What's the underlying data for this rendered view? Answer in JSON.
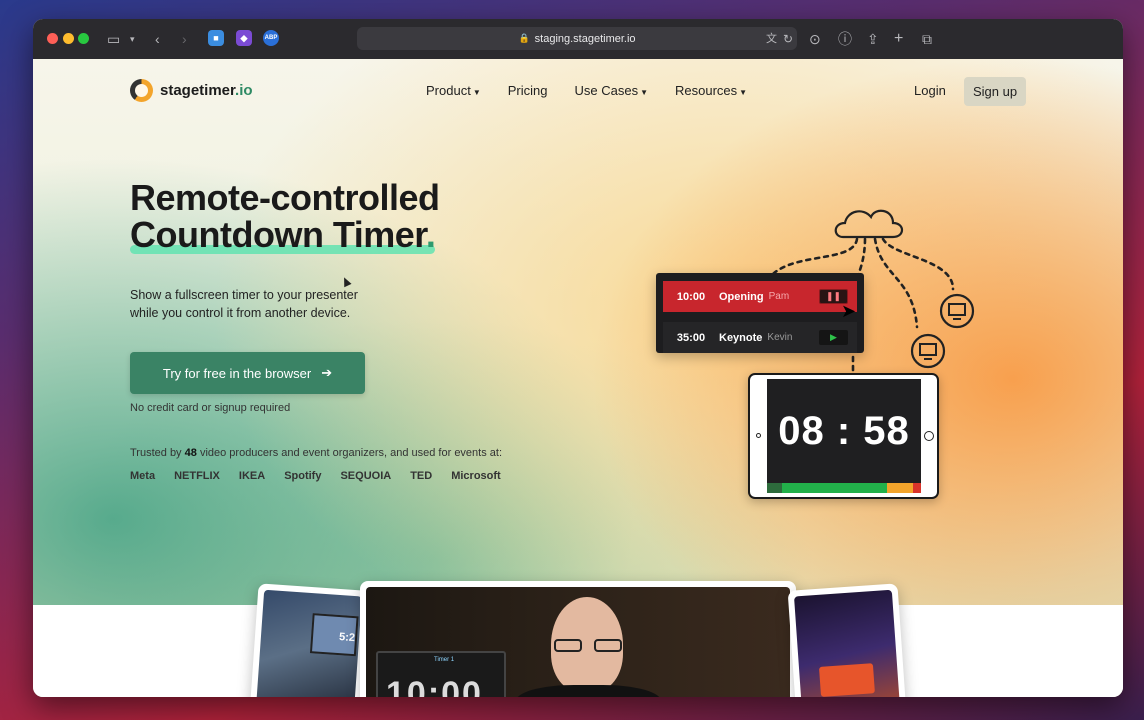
{
  "browser": {
    "url": "staging.stagetimer.io",
    "icons": [
      "sidebar-icon",
      "chevron-down-icon",
      "back-icon",
      "forward-icon",
      "lock-icon",
      "extension-icon",
      "abp-icon",
      "translate-icon",
      "reload-icon",
      "download-icon",
      "info-icon",
      "share-icon",
      "new-tab-icon",
      "tabs-icon"
    ]
  },
  "nav": {
    "brand_main": "stagetimer",
    "brand_accent": ".io",
    "links": [
      {
        "label": "Product",
        "has_menu": true
      },
      {
        "label": "Pricing",
        "has_menu": false
      },
      {
        "label": "Use Cases",
        "has_menu": true
      },
      {
        "label": "Resources",
        "has_menu": true
      }
    ],
    "login": "Login",
    "signup": "Sign up"
  },
  "hero": {
    "title_line1": "Remote-controlled",
    "title_line2": "Countdown Timer",
    "title_dot": ".",
    "subtitle": "Show a fullscreen timer to your presenter while you control it from another device.",
    "cta_label": "Try for free in the browser",
    "cta_note": "No credit card or signup required",
    "trusted_prefix": "Trusted by",
    "trusted_count": "48",
    "trusted_suffix": "video producers and event organizers, and used for events at:",
    "logos": [
      "Meta",
      "NETFLIX",
      "IKEA",
      "Spotify",
      "SEQUOIA",
      "TED",
      "Microsoft"
    ]
  },
  "illustration": {
    "rows": [
      {
        "time": "10:00",
        "name": "Opening",
        "person": "Pam",
        "state": "paused"
      },
      {
        "time": "35:00",
        "name": "Keynote",
        "person": "Kevin",
        "state": "ready"
      }
    ],
    "clock": "08 : 58",
    "colors": {
      "row_active": "#c8262d",
      "progress_green": "#22b04a",
      "progress_orange": "#f3a42b",
      "progress_red": "#d9342b"
    }
  },
  "photos": {
    "main_label": "Timer 1",
    "main_digits": "10:00",
    "left_digit": "5:2"
  },
  "colors": {
    "accent": "#3a8365",
    "underline": "#62e3b0"
  }
}
